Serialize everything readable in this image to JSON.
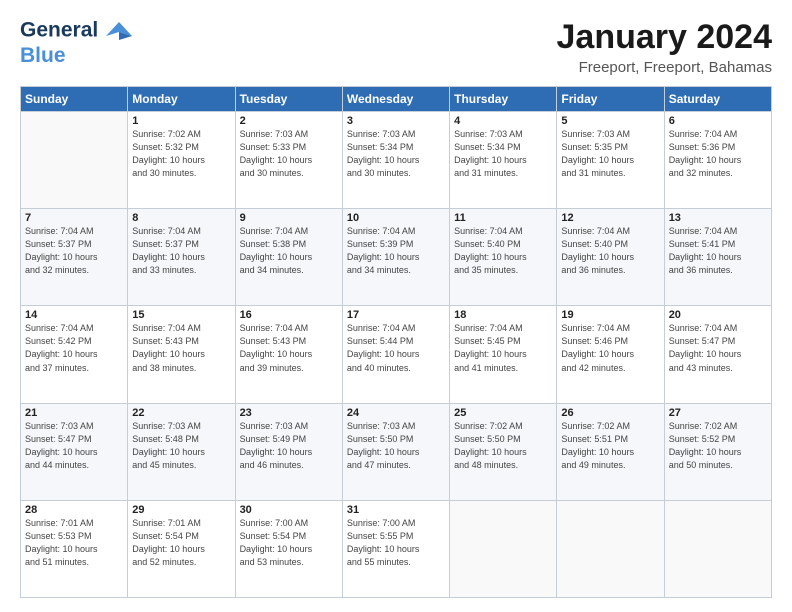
{
  "logo": {
    "line1": "General",
    "line2": "Blue"
  },
  "title": "January 2024",
  "subtitle": "Freeport, Freeport, Bahamas",
  "weekdays": [
    "Sunday",
    "Monday",
    "Tuesday",
    "Wednesday",
    "Thursday",
    "Friday",
    "Saturday"
  ],
  "weeks": [
    [
      {
        "day": "",
        "info": ""
      },
      {
        "day": "1",
        "info": "Sunrise: 7:02 AM\nSunset: 5:32 PM\nDaylight: 10 hours\nand 30 minutes."
      },
      {
        "day": "2",
        "info": "Sunrise: 7:03 AM\nSunset: 5:33 PM\nDaylight: 10 hours\nand 30 minutes."
      },
      {
        "day": "3",
        "info": "Sunrise: 7:03 AM\nSunset: 5:34 PM\nDaylight: 10 hours\nand 30 minutes."
      },
      {
        "day": "4",
        "info": "Sunrise: 7:03 AM\nSunset: 5:34 PM\nDaylight: 10 hours\nand 31 minutes."
      },
      {
        "day": "5",
        "info": "Sunrise: 7:03 AM\nSunset: 5:35 PM\nDaylight: 10 hours\nand 31 minutes."
      },
      {
        "day": "6",
        "info": "Sunrise: 7:04 AM\nSunset: 5:36 PM\nDaylight: 10 hours\nand 32 minutes."
      }
    ],
    [
      {
        "day": "7",
        "info": "Sunrise: 7:04 AM\nSunset: 5:37 PM\nDaylight: 10 hours\nand 32 minutes."
      },
      {
        "day": "8",
        "info": "Sunrise: 7:04 AM\nSunset: 5:37 PM\nDaylight: 10 hours\nand 33 minutes."
      },
      {
        "day": "9",
        "info": "Sunrise: 7:04 AM\nSunset: 5:38 PM\nDaylight: 10 hours\nand 34 minutes."
      },
      {
        "day": "10",
        "info": "Sunrise: 7:04 AM\nSunset: 5:39 PM\nDaylight: 10 hours\nand 34 minutes."
      },
      {
        "day": "11",
        "info": "Sunrise: 7:04 AM\nSunset: 5:40 PM\nDaylight: 10 hours\nand 35 minutes."
      },
      {
        "day": "12",
        "info": "Sunrise: 7:04 AM\nSunset: 5:40 PM\nDaylight: 10 hours\nand 36 minutes."
      },
      {
        "day": "13",
        "info": "Sunrise: 7:04 AM\nSunset: 5:41 PM\nDaylight: 10 hours\nand 36 minutes."
      }
    ],
    [
      {
        "day": "14",
        "info": "Sunrise: 7:04 AM\nSunset: 5:42 PM\nDaylight: 10 hours\nand 37 minutes."
      },
      {
        "day": "15",
        "info": "Sunrise: 7:04 AM\nSunset: 5:43 PM\nDaylight: 10 hours\nand 38 minutes."
      },
      {
        "day": "16",
        "info": "Sunrise: 7:04 AM\nSunset: 5:43 PM\nDaylight: 10 hours\nand 39 minutes."
      },
      {
        "day": "17",
        "info": "Sunrise: 7:04 AM\nSunset: 5:44 PM\nDaylight: 10 hours\nand 40 minutes."
      },
      {
        "day": "18",
        "info": "Sunrise: 7:04 AM\nSunset: 5:45 PM\nDaylight: 10 hours\nand 41 minutes."
      },
      {
        "day": "19",
        "info": "Sunrise: 7:04 AM\nSunset: 5:46 PM\nDaylight: 10 hours\nand 42 minutes."
      },
      {
        "day": "20",
        "info": "Sunrise: 7:04 AM\nSunset: 5:47 PM\nDaylight: 10 hours\nand 43 minutes."
      }
    ],
    [
      {
        "day": "21",
        "info": "Sunrise: 7:03 AM\nSunset: 5:47 PM\nDaylight: 10 hours\nand 44 minutes."
      },
      {
        "day": "22",
        "info": "Sunrise: 7:03 AM\nSunset: 5:48 PM\nDaylight: 10 hours\nand 45 minutes."
      },
      {
        "day": "23",
        "info": "Sunrise: 7:03 AM\nSunset: 5:49 PM\nDaylight: 10 hours\nand 46 minutes."
      },
      {
        "day": "24",
        "info": "Sunrise: 7:03 AM\nSunset: 5:50 PM\nDaylight: 10 hours\nand 47 minutes."
      },
      {
        "day": "25",
        "info": "Sunrise: 7:02 AM\nSunset: 5:50 PM\nDaylight: 10 hours\nand 48 minutes."
      },
      {
        "day": "26",
        "info": "Sunrise: 7:02 AM\nSunset: 5:51 PM\nDaylight: 10 hours\nand 49 minutes."
      },
      {
        "day": "27",
        "info": "Sunrise: 7:02 AM\nSunset: 5:52 PM\nDaylight: 10 hours\nand 50 minutes."
      }
    ],
    [
      {
        "day": "28",
        "info": "Sunrise: 7:01 AM\nSunset: 5:53 PM\nDaylight: 10 hours\nand 51 minutes."
      },
      {
        "day": "29",
        "info": "Sunrise: 7:01 AM\nSunset: 5:54 PM\nDaylight: 10 hours\nand 52 minutes."
      },
      {
        "day": "30",
        "info": "Sunrise: 7:00 AM\nSunset: 5:54 PM\nDaylight: 10 hours\nand 53 minutes."
      },
      {
        "day": "31",
        "info": "Sunrise: 7:00 AM\nSunset: 5:55 PM\nDaylight: 10 hours\nand 55 minutes."
      },
      {
        "day": "",
        "info": ""
      },
      {
        "day": "",
        "info": ""
      },
      {
        "day": "",
        "info": ""
      }
    ]
  ]
}
